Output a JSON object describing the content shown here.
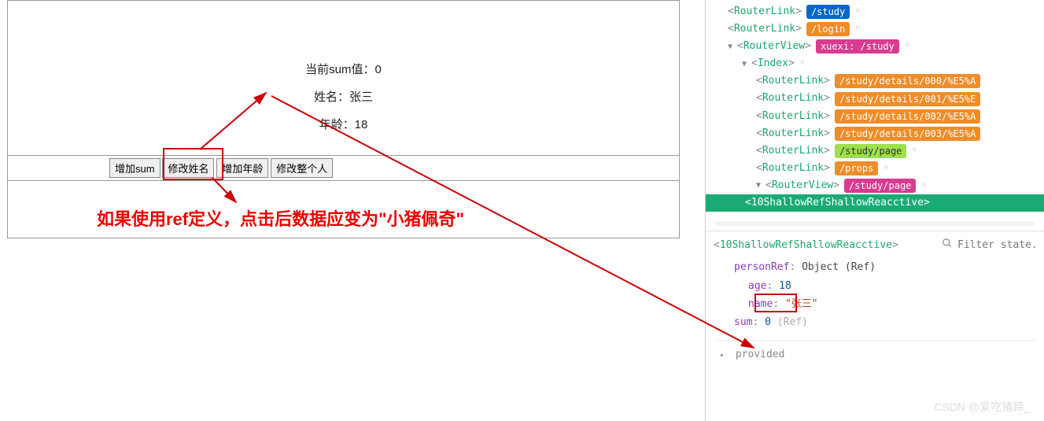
{
  "app": {
    "sum_label": "当前sum值：",
    "sum_value": "0",
    "name_label": "姓名：",
    "name_value": "张三",
    "age_label": "年龄：",
    "age_value": "18",
    "buttons": {
      "add_sum": "增加sum",
      "change_name": "修改姓名",
      "add_age": "增加年龄",
      "change_person": "修改整个人"
    }
  },
  "annotation": "如果使用ref定义，点击后数据应变为\"小猪佩奇\"",
  "devtools": {
    "tree": {
      "routerlink1": "RouterLink",
      "routerlink2": "RouterLink",
      "routerview1": "RouterView",
      "index": "Index",
      "routerlink3": "RouterLink",
      "routerlink4": "RouterLink",
      "routerlink5": "RouterLink",
      "routerlink6": "RouterLink",
      "routerlink7": "RouterLink",
      "routerlink8": "RouterLink",
      "routerview2": "RouterView",
      "selected": "10ShallowRefShallowReacctive",
      "badges": {
        "study": "/study",
        "login": "/login",
        "xuexi": "xuexi: /study",
        "details0": "/study/details/000/%E5%A",
        "details1": "/study/details/001/%E5%E",
        "details2": "/study/details/002/%E5%A",
        "details3": "/study/details/003/%E5%A",
        "page": "/study/page",
        "props": "/props",
        "page2": "/study/page"
      }
    },
    "state": {
      "title_comp": "10ShallowRefShallowReacctive",
      "filter_placeholder": "Filter state...",
      "personRef_key": "personRef",
      "personRef_type": "Object (Ref)",
      "age_key": "age",
      "age_val": "18",
      "name_key": "name",
      "name_val": "\"张三\"",
      "sum_key": "sum",
      "sum_val": "0",
      "sum_type": "(Ref)",
      "provided": "provided"
    }
  },
  "watermark": "CSDN @爱吃猪蹄_"
}
